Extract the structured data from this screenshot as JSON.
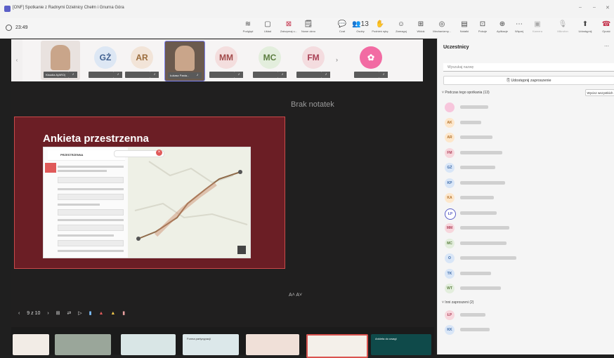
{
  "window": {
    "title": "[ONF] Spotkanie z Radnymi Dzielnicy Chełm i Gnurna Góra",
    "minimize_glyph": "–",
    "restore_glyph": "–",
    "close_glyph": "✕"
  },
  "toolbar": {
    "timer": "23:49",
    "buttons": [
      {
        "icon": "raise-hand-icon",
        "glyph": "≋",
        "label": "Podgląd"
      },
      {
        "icon": "view-icon",
        "glyph": "▢",
        "label": "Układ"
      },
      {
        "icon": "stop-sharing-icon",
        "glyph": "⊠",
        "label": "Zatrzymaj u..."
      },
      {
        "icon": "notes-icon",
        "glyph": "🗒",
        "label": "Nowe okno"
      },
      {
        "icon": "chat-icon",
        "glyph": "💬",
        "label": "Czat"
      },
      {
        "icon": "people-icon",
        "glyph": "👥",
        "label": "Osoby",
        "count": "13"
      },
      {
        "icon": "hand-icon",
        "glyph": "✋",
        "label": "Podnieś rękę"
      },
      {
        "icon": "reactions-icon",
        "glyph": "☺",
        "label": "Zareaguj"
      },
      {
        "icon": "view-grid-icon",
        "glyph": "⊞",
        "label": "Widok"
      },
      {
        "icon": "copilot-icon",
        "glyph": "◎",
        "label": "Mechanizmy..."
      },
      {
        "icon": "notes-app-icon",
        "glyph": "▤",
        "label": "Notatki"
      },
      {
        "icon": "rooms-icon",
        "glyph": "⊡",
        "label": "Pokoje"
      },
      {
        "icon": "apps-icon",
        "glyph": "⊕",
        "label": "Aplikacje"
      },
      {
        "icon": "more-icon",
        "glyph": "⋯",
        "label": "Więcej"
      },
      {
        "icon": "camera-icon",
        "glyph": "▣",
        "label": "Kamera"
      },
      {
        "icon": "mic-icon",
        "glyph": "🎙",
        "label": "Mikrofon"
      },
      {
        "icon": "share-icon",
        "glyph": "⬆",
        "label": "Udostępnij"
      },
      {
        "icon": "leave-icon",
        "glyph": "☎",
        "label": "Opuść"
      }
    ]
  },
  "participants_strip": {
    "prev_glyph": "‹",
    "next_glyph": "›",
    "tiles": [
      {
        "initials": "",
        "name": "Klaudia A(ARO)",
        "bg": "#e9e2df",
        "color": "#4a4a4a",
        "photo": true
      },
      {
        "initials": "GŻ",
        "name": "",
        "bg": "#dde7f4",
        "color": "#3f5f8f"
      },
      {
        "initials": "AR",
        "name": "",
        "bg": "#f2e4d8",
        "color": "#9a6b3b"
      },
      {
        "initials": "",
        "name": "Łukasz Pania...",
        "bg": "#6b5a4e",
        "color": "#fff",
        "photo": true,
        "active": true
      },
      {
        "initials": "MM",
        "name": "",
        "bg": "#f4dede",
        "color": "#a24a4a"
      },
      {
        "initials": "MC",
        "name": "",
        "bg": "#e3eedd",
        "color": "#5b7d3f"
      },
      {
        "initials": "FM",
        "name": "",
        "bg": "#f4dcdf",
        "color": "#a94055"
      },
      {
        "initials": "",
        "name": "",
        "bg": "#f6e6ea",
        "color": "#c04070",
        "emblem": true
      }
    ]
  },
  "stage": {
    "notes_empty": "Brak notatek",
    "slide_title": "Ankieta przestrzenna",
    "slide_counter": "9 z 10",
    "font_controls": "A˄  A˅"
  },
  "slide_screenshot": {
    "app_name": "PRZESTRZENNA",
    "search_placeholder": "",
    "close_glyph": "×"
  },
  "thumbnails": [
    {
      "label": "",
      "bg": "#f2ece6"
    },
    {
      "label": "",
      "bg": "#9aa69a"
    },
    {
      "label": "",
      "bg": "#d9e6e6"
    },
    {
      "label": "Forma partycypacji",
      "bg": "#dce8ea"
    },
    {
      "label": "",
      "bg": "#f0e0d8"
    },
    {
      "label": "",
      "bg": "#dde6ea"
    },
    {
      "label": "",
      "bg": "#f4f0ea",
      "active": true
    },
    {
      "label": "Ankieta do uwagi",
      "bg": "#0f4a4a"
    }
  ],
  "panel": {
    "title": "Uczestnicy",
    "search_placeholder": "Wyszukaj nazwę",
    "invite_label": "Udostępnij zaproszenie",
    "section_in_meeting": "Podczas tego spotkania (13)",
    "mute_all": "Wycisz wszystkich",
    "section_others": "Inni zaproszeni (2)",
    "in_meeting": [
      {
        "initials": "",
        "bg": "#f7c6dc",
        "color": "#b2356e",
        "name_w": 40
      },
      {
        "initials": "AK",
        "bg": "#fde7cc",
        "color": "#b4722a",
        "name_w": 30
      },
      {
        "initials": "AR",
        "bg": "#fde7cc",
        "color": "#b4722a",
        "name_w": 46
      },
      {
        "initials": "FM",
        "bg": "#f7d7dd",
        "color": "#b0435b",
        "name_w": 60
      },
      {
        "initials": "GŻ",
        "bg": "#d9e6f7",
        "color": "#3d6aa8",
        "name_w": 50
      },
      {
        "initials": "KP",
        "bg": "#d9e6f7",
        "color": "#3d6aa8",
        "name_w": 64
      },
      {
        "initials": "KA",
        "bg": "#fde7cc",
        "color": "#b4722a",
        "name_w": 48
      },
      {
        "initials": "ŁP",
        "bg": "#ffffff",
        "color": "#5b5fc7",
        "name_w": 52,
        "ring": true
      },
      {
        "initials": "MM",
        "bg": "#f7d7dd",
        "color": "#b0435b",
        "name_w": 70
      },
      {
        "initials": "MC",
        "bg": "#e3eedd",
        "color": "#5b7d3f",
        "name_w": 66
      },
      {
        "initials": "O",
        "bg": "#d9e6f7",
        "color": "#3d6aa8",
        "name_w": 80
      },
      {
        "initials": "TK",
        "bg": "#d9e6f7",
        "color": "#3d6aa8",
        "name_w": 44
      },
      {
        "initials": "WT",
        "bg": "#e3eedd",
        "color": "#5b7d3f",
        "name_w": 58
      }
    ],
    "others": [
      {
        "initials": "ŁP",
        "bg": "#f7d7dd",
        "color": "#b0435b",
        "name_w": 36
      },
      {
        "initials": "KK",
        "bg": "#d9e6f7",
        "color": "#3d6aa8",
        "name_w": 42
      }
    ]
  }
}
